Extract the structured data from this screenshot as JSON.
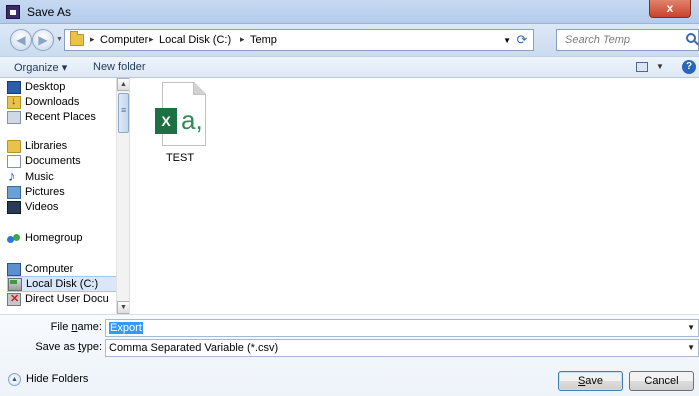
{
  "window": {
    "title": "Save As",
    "close_glyph": "x"
  },
  "address": {
    "crumbs": [
      "Computer",
      "Local Disk (C:)",
      "Temp"
    ],
    "separator": "▸",
    "search_placeholder": "Search Temp"
  },
  "toolbar": {
    "organize": "Organize ▾",
    "new_folder": "New folder",
    "help_glyph": "?"
  },
  "nav": {
    "items": [
      {
        "label": "Desktop",
        "icon": "desktop-icon"
      },
      {
        "label": "Downloads",
        "icon": "downloads-icon"
      },
      {
        "label": "Recent Places",
        "icon": "recent-places-icon"
      },
      {
        "label": "Libraries",
        "icon": "libraries-icon"
      },
      {
        "label": "Documents",
        "icon": "documents-icon"
      },
      {
        "label": "Music",
        "icon": "music-icon"
      },
      {
        "label": "Pictures",
        "icon": "pictures-icon"
      },
      {
        "label": "Videos",
        "icon": "videos-icon"
      },
      {
        "label": "Homegroup",
        "icon": "homegroup-icon"
      },
      {
        "label": "Computer",
        "icon": "computer-icon"
      },
      {
        "label": "Local Disk (C:)",
        "icon": "local-disk-icon"
      },
      {
        "label": "Direct User Docu",
        "icon": "network-drive-icon"
      }
    ],
    "selected": "Local Disk (C:)"
  },
  "files": [
    {
      "name": "TEST",
      "type": "excel-csv-icon"
    }
  ],
  "form": {
    "file_name_label_pre": "File ",
    "file_name_label_key": "n",
    "file_name_label_post": "ame:",
    "file_name_value": "Export",
    "save_type_label_pre": "Save as ",
    "save_type_label_key": "t",
    "save_type_label_post": "ype:",
    "save_type_value": "Comma Separated Variable (*.csv)"
  },
  "footer": {
    "hide_folders": "Hide Folders",
    "save_key": "S",
    "save_rest": "ave",
    "cancel": "Cancel"
  },
  "colors": {
    "accent": "#3399ff",
    "title_bar": "#c6d9f1",
    "close": "#c9422a"
  }
}
